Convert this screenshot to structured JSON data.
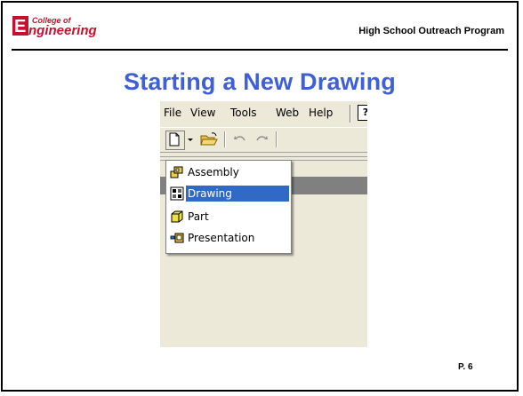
{
  "header": {
    "logo_text": "Engineering",
    "logo_small_text": "College of",
    "program": "High School Outreach Program"
  },
  "title": "Starting a New Drawing",
  "app": {
    "menu": [
      {
        "label": "File"
      },
      {
        "label": "View"
      },
      {
        "label": "Tools"
      },
      {
        "label": "Web"
      },
      {
        "label": "Help"
      }
    ],
    "help_icon": "?",
    "toolbar_icons": [
      "new-document-icon",
      "dropdown-arrow-icon",
      "open-folder-icon",
      "undo-icon",
      "redo-icon"
    ],
    "dropdown": {
      "items": [
        {
          "label": "Assembly",
          "icon": "assembly-icon"
        },
        {
          "label": "Drawing",
          "icon": "drawing-icon",
          "selected": true
        },
        {
          "label": "Part",
          "icon": "part-icon"
        },
        {
          "label": "Presentation",
          "icon": "presentation-icon"
        }
      ]
    }
  },
  "footer": {
    "page": "P. 6"
  },
  "colors": {
    "title": "#3f5fd6",
    "selection": "#316ac5",
    "panel": "#ece9d8",
    "logo_red": "#c8102e"
  }
}
